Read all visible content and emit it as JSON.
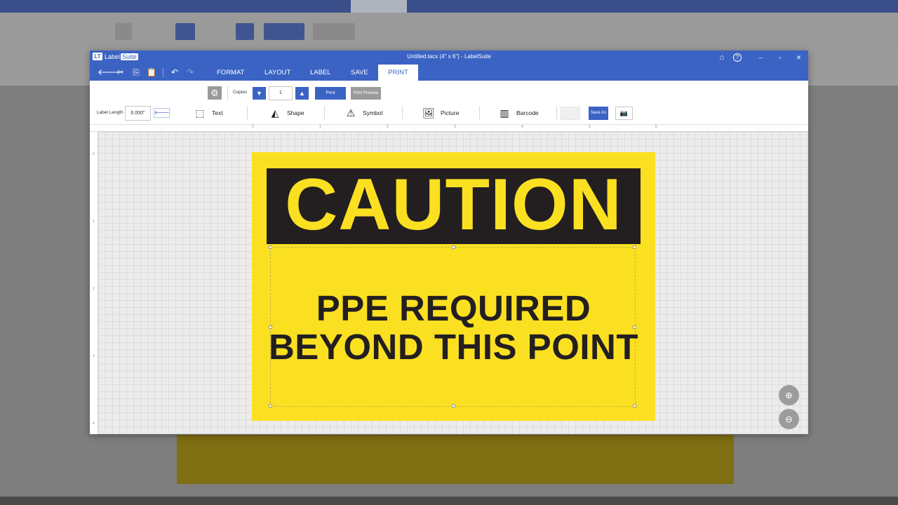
{
  "app": {
    "logo_badge": "LT",
    "logo_label": "Label",
    "logo_suite": "Suite",
    "window_title": "Untitled.tacx (4\" x 6\") - LabelSuite",
    "controls": {
      "minimize": "–",
      "maximize": "▫",
      "close": "✕"
    },
    "top_icons": {
      "home": "⌂",
      "help": "?"
    }
  },
  "menubar": {
    "icons": {
      "back": "🡐",
      "cut": "✂",
      "copy": "⎘",
      "paste": "📋",
      "undo": "↶",
      "redo": "↷"
    },
    "tabs": [
      {
        "label": "FORMAT"
      },
      {
        "label": "LAYOUT"
      },
      {
        "label": "LABEL"
      },
      {
        "label": "SAVE"
      },
      {
        "label": "PRINT"
      }
    ]
  },
  "ribbon": {
    "gear_glyph": "⚙",
    "copies_label": "Copies",
    "copies_value": "1",
    "decrement_glyph": "▼",
    "increment_glyph": "▲",
    "print_label": "Print",
    "preview_label": "Print Preview",
    "label_length_label": "Label Length",
    "label_length_value": "6.000\"",
    "apply_glyph": "🡐",
    "tools": [
      {
        "label": "Text",
        "icon": "⬚"
      },
      {
        "label": "Shape",
        "icon": "◭"
      },
      {
        "label": "Symbol",
        "icon": "⚠"
      },
      {
        "label": "Picture",
        "icon": "🖼"
      },
      {
        "label": "Barcode",
        "icon": "▥"
      }
    ],
    "save_as_label": "Save As",
    "camera_glyph": "📷"
  },
  "rulers": {
    "h": [
      "0",
      "1",
      "2",
      "3",
      "4",
      "5",
      "6"
    ],
    "v": [
      "0",
      "1",
      "2",
      "3",
      "4"
    ]
  },
  "label": {
    "header": "CAUTION",
    "line1": "PPE REQUIRED",
    "line2": "BEYOND THIS POINT"
  },
  "zoom": {
    "in": "⊕",
    "out": "⊖"
  },
  "colors": {
    "accent": "#3b63c4",
    "label_yellow": "#fbe021",
    "label_black": "#231f20"
  }
}
